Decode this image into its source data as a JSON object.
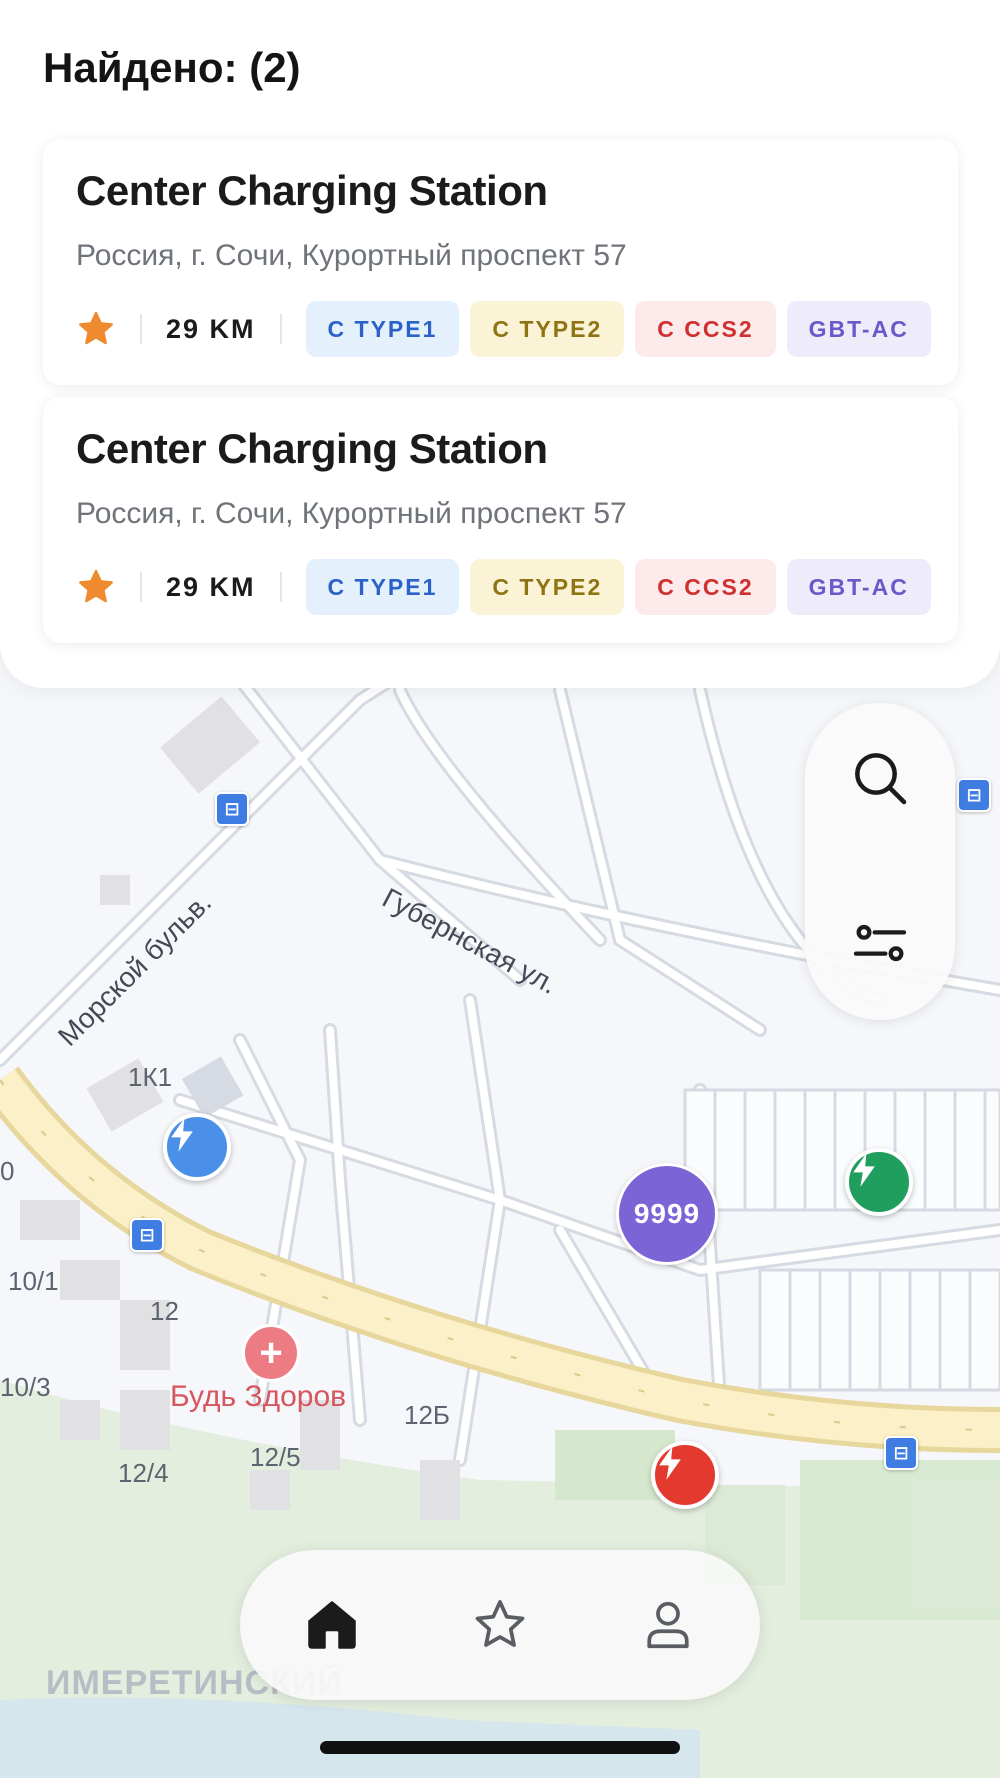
{
  "results": {
    "title": "Найдено: (2)",
    "stations": [
      {
        "name": "Center Charging Station",
        "address": "Россия, г. Сочи, Курортный проспект 57",
        "distance": "29 KM",
        "favorite": true,
        "connectors": [
          "C TYPE1",
          "C TYPE2",
          "C CCS2",
          "GBT-AC"
        ]
      },
      {
        "name": "Center Charging Station",
        "address": "Россия, г. Сочи, Курортный проспект 57",
        "distance": "29 KM",
        "favorite": true,
        "connectors": [
          "C TYPE1",
          "C TYPE2",
          "C CCS2",
          "GBT-AC"
        ]
      }
    ]
  },
  "map": {
    "streets": [
      "Губернская ул.",
      "Морской бульв."
    ],
    "house_numbers": [
      "1К1",
      "10/1",
      "12",
      "10/3",
      "12Б",
      "12/5",
      "12/4",
      "0"
    ],
    "district": "ИМЕРЕТИНСКИЙ",
    "poi": "Будь Здоров",
    "cluster_count": "9999",
    "marker_colors": {
      "blue": "#4a90e8",
      "green": "#1f9e5e",
      "red": "#e4392f",
      "cluster": "#7b64d6"
    }
  },
  "controls": {
    "search_icon": "search-icon",
    "filter_icon": "filter-icon"
  },
  "nav": {
    "items": [
      {
        "icon": "home-icon",
        "active": true
      },
      {
        "icon": "star-icon",
        "active": false
      },
      {
        "icon": "profile-icon",
        "active": false
      }
    ]
  },
  "colors": {
    "favorite_star": "#f08a2e",
    "tag_type1": "#2a62c8",
    "tag_type2": "#8e7412",
    "tag_ccs2": "#cf3030",
    "tag_gbt": "#6b59c9"
  }
}
